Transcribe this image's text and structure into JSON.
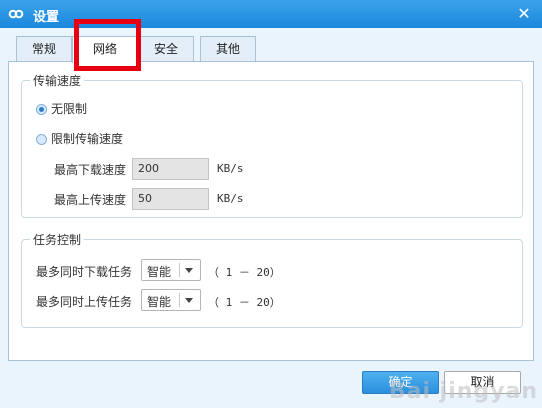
{
  "window": {
    "title": "设置"
  },
  "tabs": [
    {
      "label": "常规"
    },
    {
      "label": "网络",
      "active": true
    },
    {
      "label": "安全"
    },
    {
      "label": "其他"
    }
  ],
  "speed_group": {
    "legend": "传输速度",
    "options": [
      {
        "label": "无限制",
        "checked": true
      },
      {
        "label": "限制传输速度",
        "checked": false
      }
    ],
    "max_download": {
      "label": "最高下载速度",
      "value": "200",
      "unit": "KB/s"
    },
    "max_upload": {
      "label": "最高上传速度",
      "value": "50",
      "unit": "KB/s"
    }
  },
  "task_group": {
    "legend": "任务控制",
    "max_download_tasks": {
      "label": "最多同时下载任务",
      "value": "智能",
      "range": "（ 1 － 20）"
    },
    "max_upload_tasks": {
      "label": "最多同时上传任务",
      "value": "智能",
      "range": "（ 1 － 20）"
    }
  },
  "buttons": {
    "ok": "确定",
    "cancel": "取消"
  },
  "watermark": "Bai jingyan",
  "colors": {
    "titlebar": "#1c88dc",
    "highlight": "#e60012",
    "ok_button": "#2b8fdd"
  }
}
